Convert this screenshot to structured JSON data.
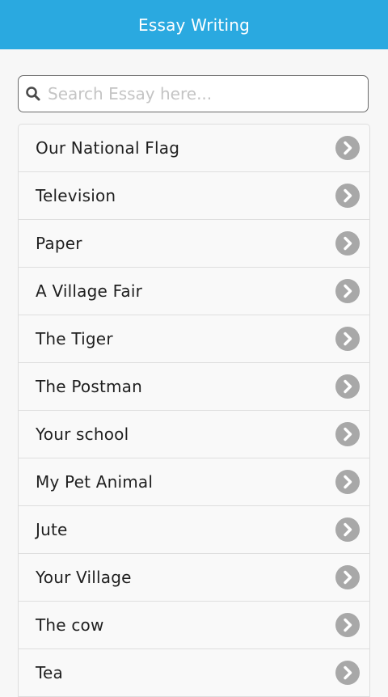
{
  "header": {
    "title": "Essay Writing"
  },
  "search": {
    "placeholder": "Search Essay here...",
    "value": "",
    "icon": "search-icon"
  },
  "essays": [
    {
      "label": "Our National Flag",
      "icon": "chevron-right-icon"
    },
    {
      "label": "Television",
      "icon": "chevron-right-icon"
    },
    {
      "label": "Paper",
      "icon": "chevron-right-icon"
    },
    {
      "label": "A Village Fair",
      "icon": "chevron-right-icon"
    },
    {
      "label": "The Tiger",
      "icon": "chevron-right-icon"
    },
    {
      "label": "The Postman",
      "icon": "chevron-right-icon"
    },
    {
      "label": "Your school",
      "icon": "chevron-right-icon"
    },
    {
      "label": "My Pet Animal",
      "icon": "chevron-right-icon"
    },
    {
      "label": "Jute",
      "icon": "chevron-right-icon"
    },
    {
      "label": "Your Village",
      "icon": "chevron-right-icon"
    },
    {
      "label": "The cow",
      "icon": "chevron-right-icon"
    },
    {
      "label": "Tea",
      "icon": "chevron-right-icon"
    }
  ],
  "colors": {
    "header_bg": "#2aa9e0",
    "chevron_bg": "#a8a8a8"
  }
}
